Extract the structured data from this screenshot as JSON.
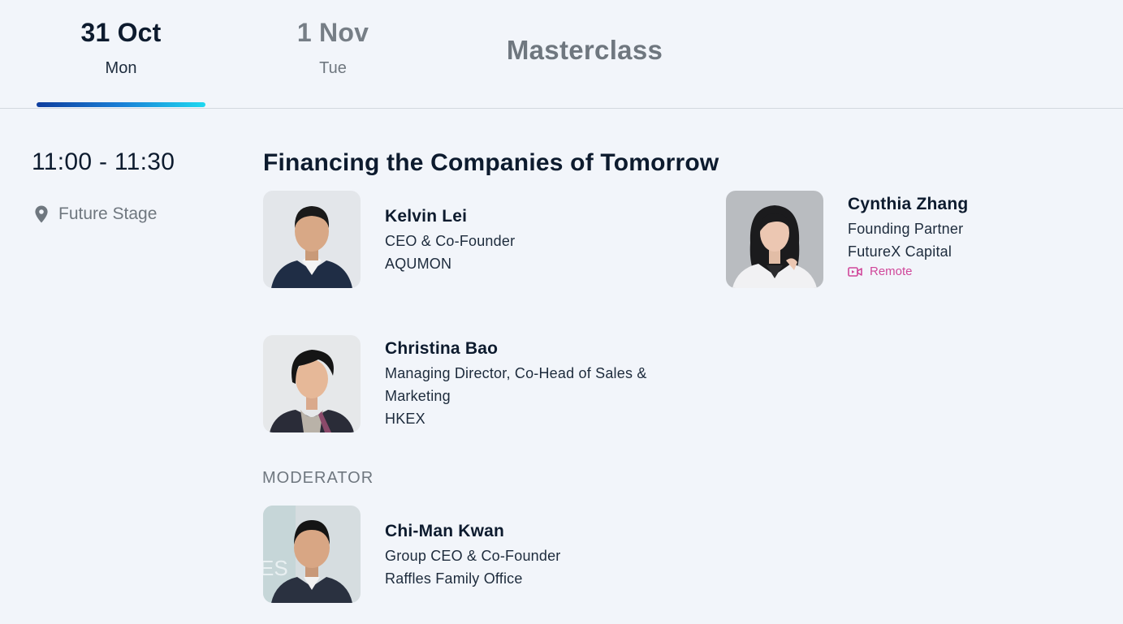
{
  "tabs": [
    {
      "date": "31 Oct",
      "weekday": "Mon",
      "active": true
    },
    {
      "date": "1 Nov",
      "weekday": "Tue",
      "active": false
    },
    {
      "label": "Masterclass",
      "active": false
    }
  ],
  "colors": {
    "background": "#f2f5fa",
    "text_primary": "#0d1b2e",
    "text_muted": "#6f777f",
    "accent_gradient_start": "#0f3e9e",
    "accent_gradient_end": "#1fd8f0",
    "remote": "#d0479a"
  },
  "session": {
    "time": "11:00 - 11:30",
    "location_icon": "map-pin-icon",
    "location": "Future Stage",
    "title": "Financing the Companies of Tomorrow"
  },
  "speakers": [
    {
      "name": "Kelvin Lei",
      "role": "CEO & Co-Founder",
      "company": "AQUMON"
    },
    {
      "name": "Cynthia Zhang",
      "role": "Founding Partner",
      "company": "FutureX Capital",
      "remote_label": "Remote",
      "remote_icon": "video-camera-icon"
    },
    {
      "name": "Christina Bao",
      "role": "Managing Director, Co-Head of Sales & Marketing",
      "company": "HKEX"
    }
  ],
  "moderator": {
    "heading": "MODERATOR",
    "name": "Chi-Man Kwan",
    "role": "Group CEO & Co-Founder",
    "company": "Raffles Family Office"
  }
}
